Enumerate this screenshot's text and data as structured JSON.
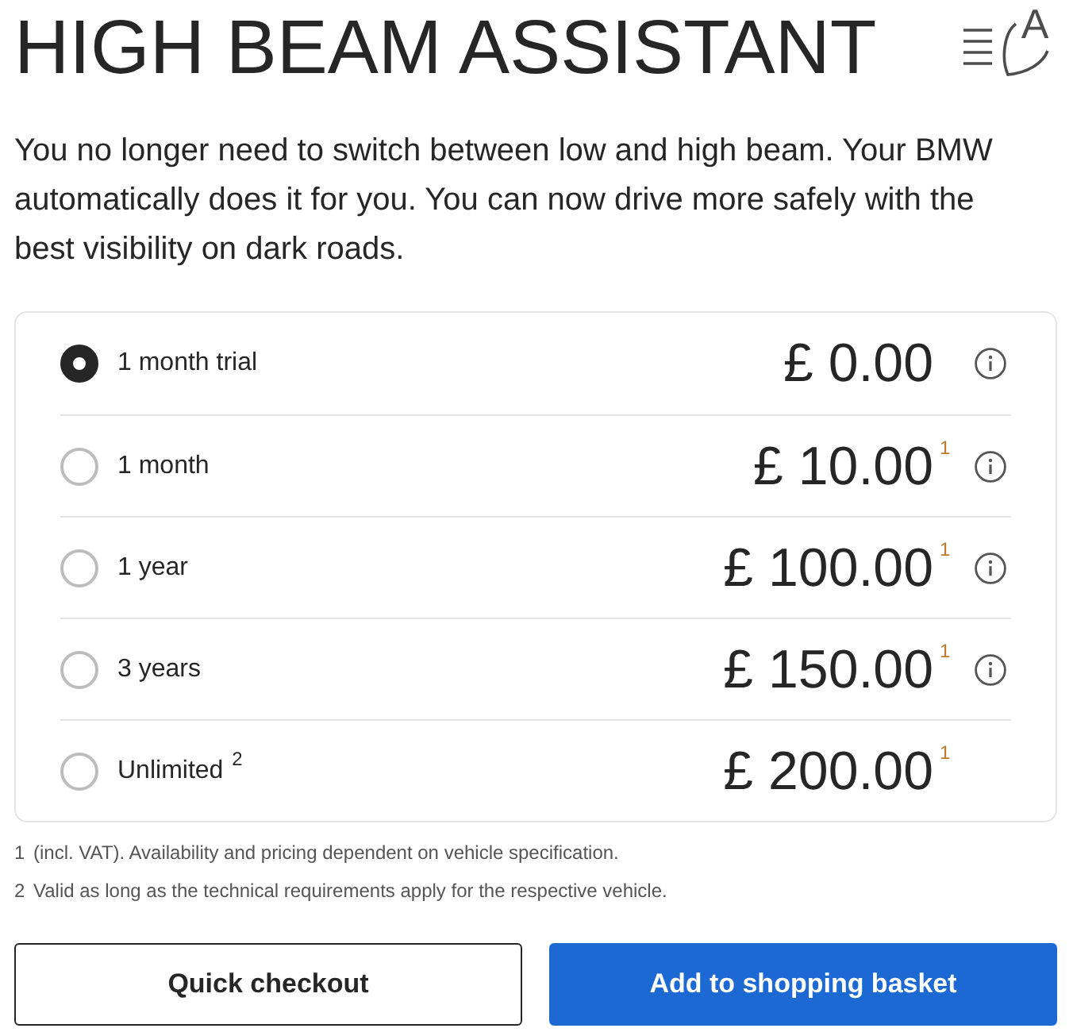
{
  "header": {
    "title": "HIGH BEAM ASSISTANT",
    "icon_letter": "A"
  },
  "description": "You no longer need to switch between low and high beam. Your BMW automatically does it for you. You can now drive more safely with the best visibility on dark roads.",
  "options": [
    {
      "label": "1 month trial",
      "price": "£ 0.00",
      "selected": true,
      "info_icon": true
    },
    {
      "label": "1 month",
      "price": "£ 10.00",
      "price_note": "1",
      "selected": false,
      "info_icon": true
    },
    {
      "label": "1 year",
      "price": "£ 100.00",
      "price_note": "1",
      "selected": false,
      "info_icon": true
    },
    {
      "label": "3 years",
      "price": "£ 150.00",
      "price_note": "1",
      "selected": false,
      "info_icon": true
    },
    {
      "label": "Unlimited $^{2}$",
      "price": "£ 200.00",
      "price_note": "1",
      "selected": false,
      "info_icon": false
    }
  ],
  "footnotes": [
    {
      "mark": "1",
      "text": "(incl. VAT). Availability and pricing dependent on vehicle specification."
    },
    {
      "mark": "2",
      "text": "Valid as long as the technical requirements apply for the respective vehicle."
    }
  ],
  "buttons": [
    {
      "label": "Quick checkout",
      "kind": "secondary"
    },
    {
      "label": "Add to shopping basket",
      "kind": "primary"
    }
  ]
}
